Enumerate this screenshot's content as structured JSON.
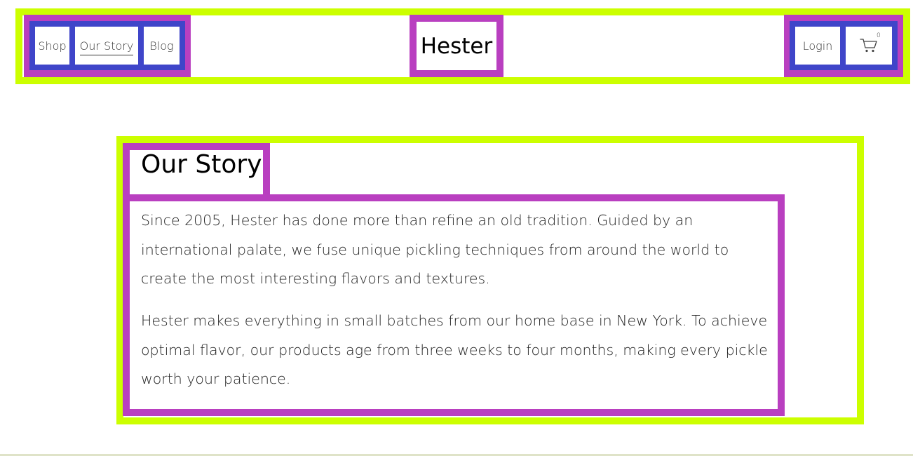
{
  "header": {
    "brand": "Hester",
    "nav": {
      "shop": "Shop",
      "our_story": "Our Story",
      "blog": "Blog"
    },
    "login": "Login",
    "cart_count": "0",
    "cart_icon": "cart-icon"
  },
  "main": {
    "title": "Our Story",
    "paragraphs": [
      "Since 2005, Hester has done more than refine an old tradition. Guided by an international palate, we fuse unique pickling techniques from around the world to create the most interesting flavors and textures.",
      "Hester makes everything in small batches from our home base in New York. To achieve optimal flavor, our products age from three weeks to four months, making every pickle worth your patience."
    ]
  },
  "colors": {
    "lime_outline": "#ccff00",
    "purple_outline": "#b93fc0",
    "blue_outline": "#3f45c9"
  }
}
